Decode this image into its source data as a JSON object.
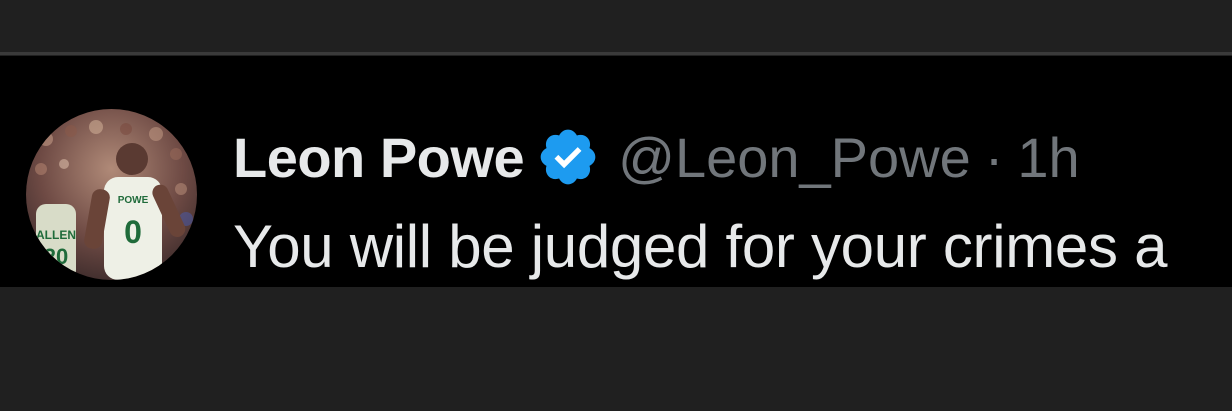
{
  "tweet": {
    "display_name": "Leon Powe",
    "handle": "@Leon_Powe",
    "separator": "·",
    "timestamp": "1h",
    "text": "You will be judged for your crimes a",
    "verified": true,
    "verified_icon": "verified-badge-icon",
    "avatar_jersey_number": "0",
    "colors": {
      "background": "#000000",
      "page_background": "#202020",
      "name": "#e7e9ea",
      "secondary": "#71767b",
      "verified_badge": "#1d9bf0"
    }
  }
}
